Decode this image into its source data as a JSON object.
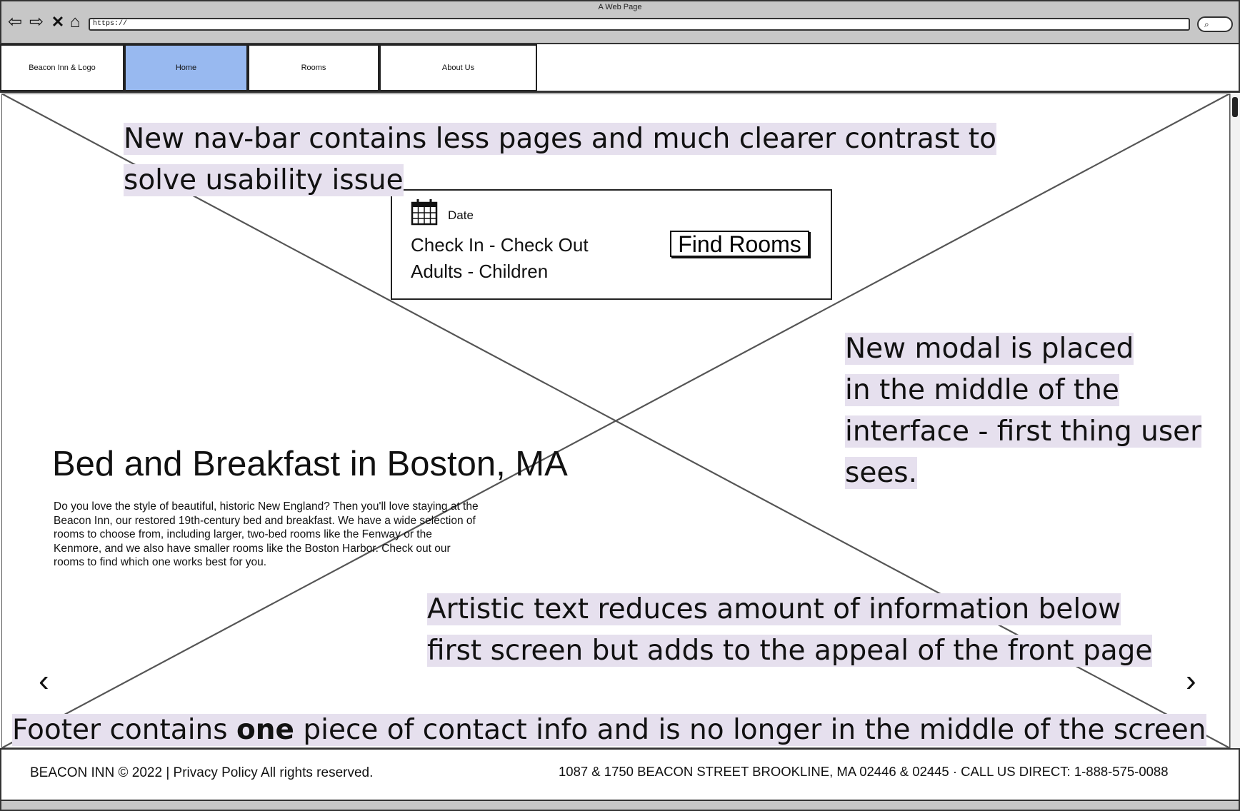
{
  "browser": {
    "window_title": "A Web Page",
    "url": "https://",
    "search_icon": "search-icon"
  },
  "nav": {
    "logo": "Beacon Inn & Logo",
    "home": "Home",
    "rooms": "Rooms",
    "about": "About Us",
    "active_color": "#98b9f0"
  },
  "booking": {
    "date_label": "Date",
    "check_in_out": "Check In - Check Out",
    "guests": "Adults - Children",
    "find_rooms": "Find Rooms"
  },
  "hero": {
    "title": "Bed and Breakfast in Boston, MA",
    "description": "Do you love the style of beautiful, historic New England? Then you'll love staying at the Beacon Inn, our restored 19th-century bed and breakfast. We have a wide selection of rooms to choose from, including larger, two-bed rooms like the Fenway or the Kenmore, and we also have smaller rooms like the Boston Harbor. Check out our rooms to find which one works best for you.",
    "prev_arrow": "‹",
    "next_arrow": "›"
  },
  "annotations": {
    "nav": "New nav-bar contains less pages and much clearer contrast to solve usability issue",
    "modal_1": "New modal is placed",
    "modal_2": "in the middle of the",
    "modal_3": "interface - first thing user",
    "modal_4": "sees.",
    "artistic_1": "Artistic text reduces amount of information below",
    "artistic_2": "first screen but adds to the appeal of the front page",
    "footer_pre": "Footer contains ",
    "footer_bold": "one",
    "footer_post": " piece of contact info and is no longer in the middle of the screen",
    "highlight_color": "#e6e0ee"
  },
  "footer": {
    "left": "BEACON INN © 2022 | Privacy Policy All rights reserved.",
    "right": "1087 & 1750 BEACON STREET BROOKLINE, MA 02446 & 02445 · CALL US DIRECT: 1-888-575-0088"
  }
}
